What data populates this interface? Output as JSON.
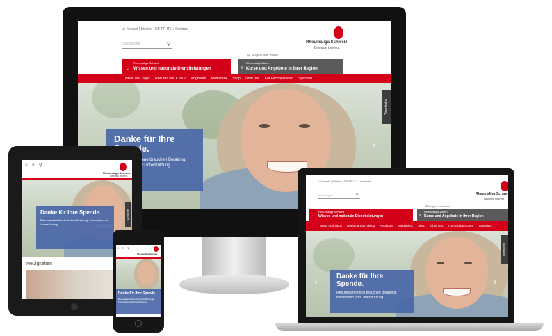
{
  "topbar": {
    "links": [
      "Kontakt",
      "Medien",
      "DE",
      "FR",
      "IT",
      "Kontrast"
    ]
  },
  "logo": {
    "name": "Rheumaliga Schweiz",
    "tagline": "Bewusst bewegt"
  },
  "search": {
    "placeholder": "Suchbegriff"
  },
  "region_label": "Region wechseln",
  "left_menu": {
    "kicker": "Rheumaliga Schweiz",
    "title": "Wissen und nationale Dienstleistungen"
  },
  "right_menu": {
    "kicker": "Rheumaliga Zürich",
    "title": "Kurse und Angebote in Ihrer Region"
  },
  "nav": [
    "News und Tipps",
    "Rheuma von A bis Z",
    "Angebote",
    "Mediathek",
    "Shop",
    "Über uns",
    "Für Fachpersonen",
    "Spenden"
  ],
  "hero": {
    "title_monitor": "Danke für Ihre",
    "title_monitor_2": "Spende.",
    "title_full": "Danke für Ihre Spende.",
    "text": "Rheumabetroffene brauchen Beratung, Information und Unterstützung."
  },
  "side_tab": "Direktlinks",
  "tablet": {
    "section": "Neuigkeiten"
  },
  "colors": {
    "brand_red": "#d4001a",
    "hero_blue": "#4a67a8",
    "grey_menu": "#5a5a5a"
  }
}
